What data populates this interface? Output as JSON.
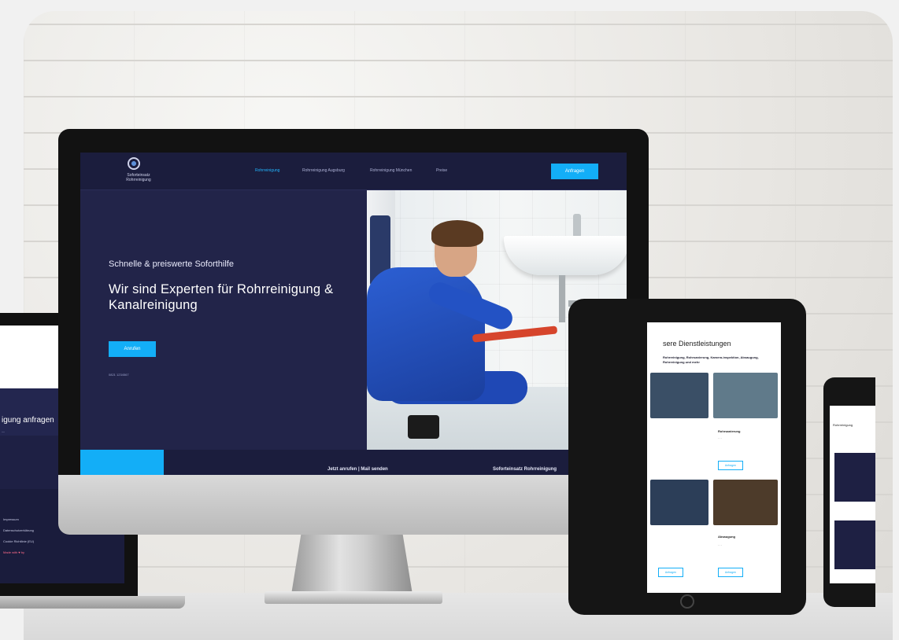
{
  "monitor": {
    "logo_line1": "Soforteinsatz",
    "logo_line2": "Rohrreinigung",
    "nav": [
      "Rohrreinigung",
      "Rohrreinigung Augsburg",
      "Rohrreinigung München",
      "Preise"
    ],
    "cta": "Anfragen",
    "hero_subtitle": "Schnelle & preiswerte Soforthilfe",
    "hero_title": "Wir sind Experten für Rohrreinigung & Kanalreinigung",
    "hero_button": "Anrufen",
    "hero_tiny": "0821 1234567",
    "bottom_center": "Jetzt anrufen | Mail senden",
    "bottom_right": "Soforteinsatz Rohrreinigung"
  },
  "laptop": {
    "heading": "igung anfragen",
    "footer": [
      "Impressum",
      "Datenschutzerklärung",
      "Cookie Richtlinie (EU)",
      "Made with ♥ by"
    ]
  },
  "tablet": {
    "title": "sere Dienstleistungen",
    "subtitle": "Rohrreinigung, Rohrsanierung, Kamera-inspektion, Absaugung, Rohrreinigung und mehr",
    "card1_title": "Rohrsanierung",
    "card2_title": "Absaugung",
    "button": "Anfragen"
  },
  "phone": {
    "label": "Rohrreinigung"
  },
  "colors": {
    "navy": "#1e2043",
    "accent": "#13aef7"
  }
}
